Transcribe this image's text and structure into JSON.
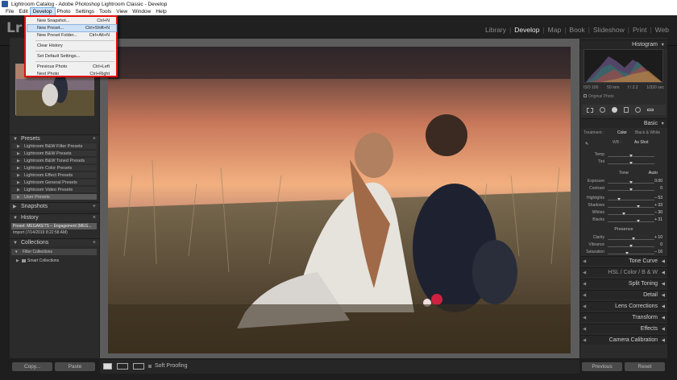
{
  "window": {
    "title": "Lightroom Catalog - Adobe Photoshop Lightroom Classic - Develop"
  },
  "menubar": [
    "File",
    "Edit",
    "Develop",
    "Photo",
    "Settings",
    "Tools",
    "View",
    "Window",
    "Help"
  ],
  "logo": "Lr",
  "modules": [
    "Library",
    "Develop",
    "Map",
    "Book",
    "Slideshow",
    "Print",
    "Web"
  ],
  "develop_menu": {
    "items": [
      {
        "label": "New Snapshot...",
        "shortcut": "Ctrl+N"
      },
      {
        "label": "New Preset...",
        "shortcut": "Ctrl+Shift+N"
      },
      {
        "label": "New Preset Folder...",
        "shortcut": "Ctrl+Alt+N"
      },
      {
        "label": "Clear History",
        "shortcut": ""
      },
      {
        "label": "Set Default Settings...",
        "shortcut": ""
      },
      {
        "label": "Previous Photo",
        "shortcut": "Ctrl+Left"
      },
      {
        "label": "Next Photo",
        "shortcut": "Ctrl+Right"
      }
    ],
    "highlighted": "New Preset..."
  },
  "left_panel": {
    "presets_title": "Presets",
    "presets": [
      "Lightroom B&W Filter Presets",
      "Lightroom B&W Presets",
      "Lightroom B&W Toned Presets",
      "Lightroom Color Presets",
      "Lightroom Effect Presets",
      "Lightroom General Presets",
      "Lightroom Video Presets",
      "User Presets"
    ],
    "snapshots_title": "Snapshots",
    "history_title": "History",
    "history": [
      "Preset: MEGAKETS – Engagement (MEG...",
      "Import (7/14/2019 8:22:58 AM)"
    ],
    "collections_title": "Collections",
    "collections": [
      "Filter Collections",
      "Smart Collections"
    ],
    "copy_label": "Copy...",
    "paste_label": "Paste"
  },
  "toolbar": {
    "soft_proofing": "Soft Proofing"
  },
  "right_panel": {
    "histogram_title": "Histogram",
    "exif": [
      "ISO 100",
      "50 mm",
      "f / 2.2",
      "1/320 sec"
    ],
    "original_photo": "Original Photo",
    "basic_title": "Basic",
    "treatment_label": "Treatment :",
    "treatment_color": "Color",
    "treatment_bw": "Black & White",
    "wb_label": "WB :",
    "wb_value": "As Shot",
    "tone_label": "Tone",
    "tone_auto": "Auto",
    "presence_label": "Presence",
    "sliders": [
      {
        "name": "Temp",
        "value": "",
        "pos": 0.5
      },
      {
        "name": "Tint",
        "value": "",
        "pos": 0.5
      },
      {
        "name": "Exposure",
        "value": "0.00",
        "pos": 0.5
      },
      {
        "name": "Contrast",
        "value": "0",
        "pos": 0.5
      },
      {
        "name": "Highlights",
        "value": "– 53",
        "pos": 0.24
      },
      {
        "name": "Shadows",
        "value": "+ 33",
        "pos": 0.66
      },
      {
        "name": "Whites",
        "value": "– 30",
        "pos": 0.35
      },
      {
        "name": "Blacks",
        "value": "+ 31",
        "pos": 0.65
      },
      {
        "name": "Clarity",
        "value": "+ 10",
        "pos": 0.55
      },
      {
        "name": "Vibrance",
        "value": "0",
        "pos": 0.5
      },
      {
        "name": "Saturation",
        "value": "– 16",
        "pos": 0.42
      }
    ],
    "sections": [
      "Tone Curve",
      "HSL / Color / B & W",
      "Split Toning",
      "Detail",
      "Lens Corrections",
      "Transform",
      "Effects",
      "Camera Calibration"
    ],
    "previous_label": "Previous",
    "reset_label": "Reset"
  },
  "colors": {
    "menu_highlight": "#cce0f6",
    "annotation_red": "#e01010",
    "panel_bg": "#2b2b2b"
  }
}
